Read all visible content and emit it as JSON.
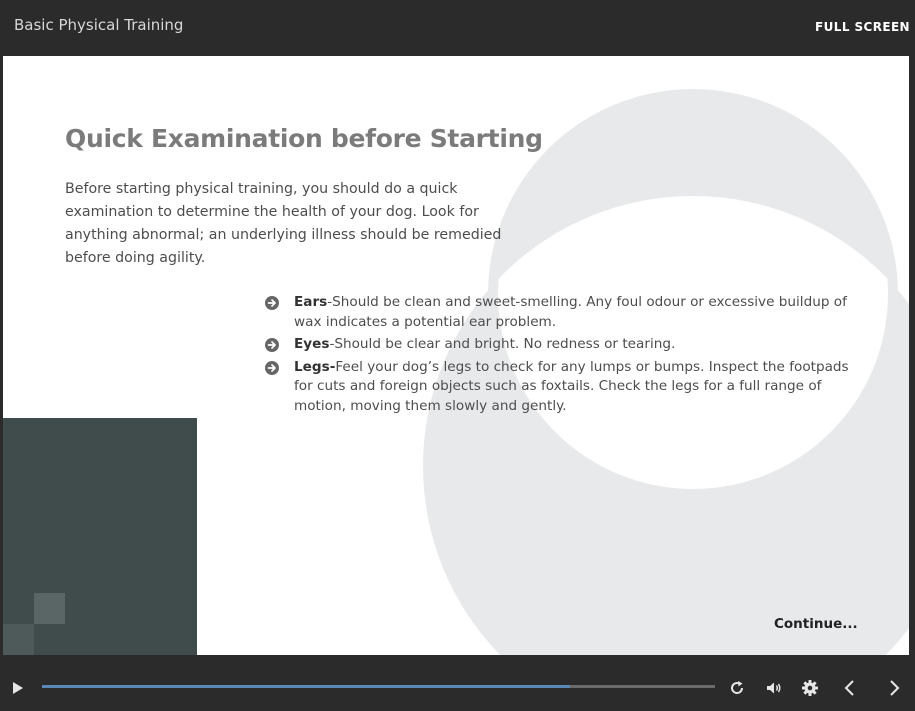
{
  "player": {
    "course_title": "Basic Physical Training",
    "fullscreen_label": "FULL SCREEN",
    "progress": 0.785
  },
  "slide": {
    "title": "Quick Examination before Starting",
    "intro": "Before starting physical training, you should do a quick examination to determine the health of your dog. Look for anything abnormal; an underlying illness should be remedied before doing agility.",
    "bullets": [
      {
        "term": "Ears",
        "text": "-Should be clean and sweet-smelling. Any foul odour or excessive buildup of wax indicates a potential ear problem."
      },
      {
        "term": "Eyes",
        "text": "-Should be clear and bright. No redness or tearing."
      },
      {
        "term": "Legs-",
        "text": "Feel your dog’s legs to check for any lumps or bumps. Inspect the footpads for cuts and foreign objects such as foxtails. Check the legs for a full range of motion, moving them slowly and gently."
      }
    ],
    "continue_label": "Continue..."
  },
  "controls": {
    "icons": [
      "play-icon",
      "replay-icon",
      "volume-icon",
      "settings-icon",
      "previous-icon",
      "next-icon"
    ]
  },
  "colors": {
    "accent": "#5b86b8",
    "chrome": "#2b2b2b",
    "dark_block": "#404b4b",
    "ring": "#e8e9ea"
  }
}
